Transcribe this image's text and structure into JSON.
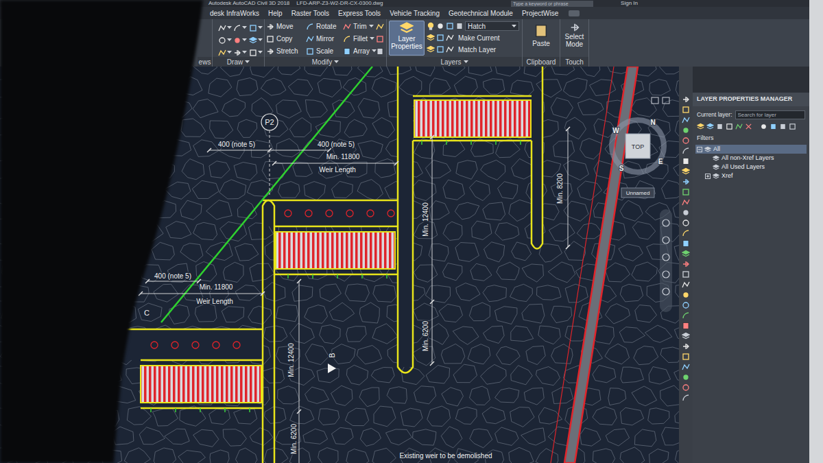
{
  "title_bar": {
    "title": "Autodesk AutoCAD Civil 3D 2018",
    "file": "LFD-ARP-Z3-W2-DR-CX-0300.dwg",
    "search": {
      "placeholder": "Type a keyword or phrase"
    },
    "sign_in": "Sign In"
  },
  "menu_tabs": [
    {
      "label": "desk InfraWorks",
      "selected": false
    },
    {
      "label": "Help",
      "selected": false
    },
    {
      "label": "Raster Tools",
      "selected": false
    },
    {
      "label": "Express Tools",
      "selected": false
    },
    {
      "label": "Vehicle Tracking",
      "selected": false
    },
    {
      "label": "Geotechnical Module",
      "selected": false
    },
    {
      "label": "ProjectWise",
      "selected": false
    }
  ],
  "ribbon": {
    "views": {
      "label": "ews"
    },
    "draw": {
      "label": "Draw"
    },
    "modify": {
      "label": "Modify",
      "tools": [
        "Move",
        "Rotate",
        "Trim",
        "Copy",
        "Mirror",
        "Fillet",
        "Stretch",
        "Scale",
        "Array"
      ]
    },
    "layers": {
      "label": "Layers",
      "layer_properties": {
        "label": "Layer Properties",
        "selected": true
      },
      "current_layer": "Hatch",
      "actions": [
        "Make Current",
        "Match Layer"
      ]
    },
    "clipboard": {
      "label": "Clipboard",
      "paste": "Paste"
    },
    "touch": {
      "label": "Touch",
      "select_mode": "Select Mode"
    }
  },
  "drawing": {
    "annotations": [
      "P2",
      "400 (note 5)",
      "400 (note 5)",
      "Min. 11800",
      "Weir Length",
      "400 (note 5)",
      "Min. 11800",
      "Weir Length",
      "Min. 12400",
      "Min. 8200",
      "Min. 6200",
      "Min. 12400",
      "Min. 6200",
      "B",
      "C",
      "Existing weir to be demolished"
    ],
    "viewcube": {
      "directions": [
        "N",
        "E",
        "S",
        "W"
      ],
      "face": "TOP"
    },
    "ucs_label": "Unnamed"
  },
  "layer_manager": {
    "title": "LAYER PROPERTIES MANAGER",
    "current_layer_label": "Current layer:",
    "search": {
      "placeholder": "Search for layer"
    },
    "filters_label": "Filters",
    "tree": [
      {
        "label": "All",
        "selected": true,
        "expanded": true,
        "children": [
          {
            "label": "All non-Xref Layers",
            "selected": false
          },
          {
            "label": "All Used Layers",
            "selected": false
          },
          {
            "label": "Xref",
            "selected": false,
            "expanded": false
          }
        ]
      }
    ]
  }
}
